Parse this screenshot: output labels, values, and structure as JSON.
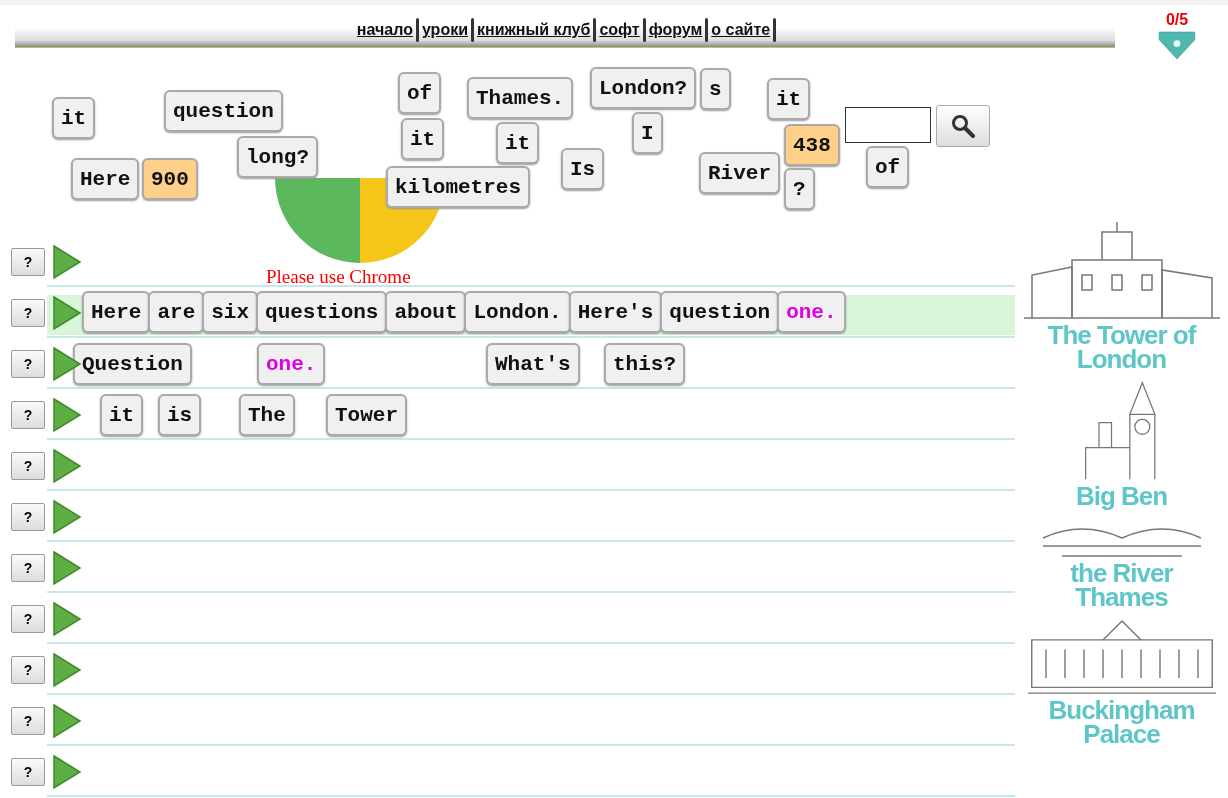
{
  "nav": {
    "links": [
      "начало",
      "уроки",
      "книжный клуб",
      "софт",
      "форум",
      "о сайте"
    ]
  },
  "score": "0/5",
  "notice": "Please use Chrome",
  "pile": [
    {
      "text": "of",
      "kind": "word"
    },
    {
      "text": "Thames.",
      "kind": "word"
    },
    {
      "text": "London?",
      "kind": "word"
    },
    {
      "text": "s",
      "kind": "word"
    },
    {
      "text": "it",
      "kind": "word"
    },
    {
      "text": "it",
      "kind": "word"
    },
    {
      "text": "question",
      "kind": "word"
    },
    {
      "text": "it",
      "kind": "word"
    },
    {
      "text": "it",
      "kind": "word"
    },
    {
      "text": "I",
      "kind": "word"
    },
    {
      "text": "438",
      "kind": "number"
    },
    {
      "text": "Here",
      "kind": "word"
    },
    {
      "text": "900",
      "kind": "number"
    },
    {
      "text": "long?",
      "kind": "word"
    },
    {
      "text": "kilometres",
      "kind": "word"
    },
    {
      "text": "Is",
      "kind": "word"
    },
    {
      "text": "River",
      "kind": "word"
    },
    {
      "text": "?",
      "kind": "word"
    },
    {
      "text": "of",
      "kind": "word"
    }
  ],
  "rows": [
    {
      "selected": false,
      "tiles": []
    },
    {
      "selected": true,
      "tiles": [
        {
          "text": "Here",
          "kind": "word"
        },
        {
          "text": "are",
          "kind": "word"
        },
        {
          "text": "six",
          "kind": "word"
        },
        {
          "text": "questions",
          "kind": "word"
        },
        {
          "text": "about",
          "kind": "word"
        },
        {
          "text": "London.",
          "kind": "word"
        },
        {
          "text": "Here's",
          "kind": "word"
        },
        {
          "text": "question",
          "kind": "word"
        },
        {
          "text": "one.",
          "kind": "accent"
        }
      ]
    },
    {
      "selected": false,
      "tiles": [
        {
          "text": "Question",
          "kind": "word"
        },
        {
          "text": "one.",
          "kind": "accent"
        },
        {
          "text": "What's",
          "kind": "word"
        },
        {
          "text": "this?",
          "kind": "word"
        }
      ]
    },
    {
      "selected": false,
      "tiles": [
        {
          "text": "it",
          "kind": "word"
        },
        {
          "text": "is",
          "kind": "word"
        },
        {
          "text": "The",
          "kind": "word"
        },
        {
          "text": "Tower",
          "kind": "word"
        }
      ]
    },
    {
      "selected": false,
      "tiles": []
    },
    {
      "selected": false,
      "tiles": []
    },
    {
      "selected": false,
      "tiles": []
    },
    {
      "selected": false,
      "tiles": []
    },
    {
      "selected": false,
      "tiles": []
    },
    {
      "selected": false,
      "tiles": []
    },
    {
      "selected": false,
      "tiles": []
    }
  ],
  "hint_button": "?",
  "landmarks": [
    {
      "kind": "tower",
      "caption": "The Tower of London"
    },
    {
      "kind": "clock",
      "caption": "Big Ben"
    },
    {
      "kind": "river",
      "caption": "the River Thames"
    },
    {
      "kind": "palace",
      "caption": "Buckingham Palace"
    }
  ]
}
